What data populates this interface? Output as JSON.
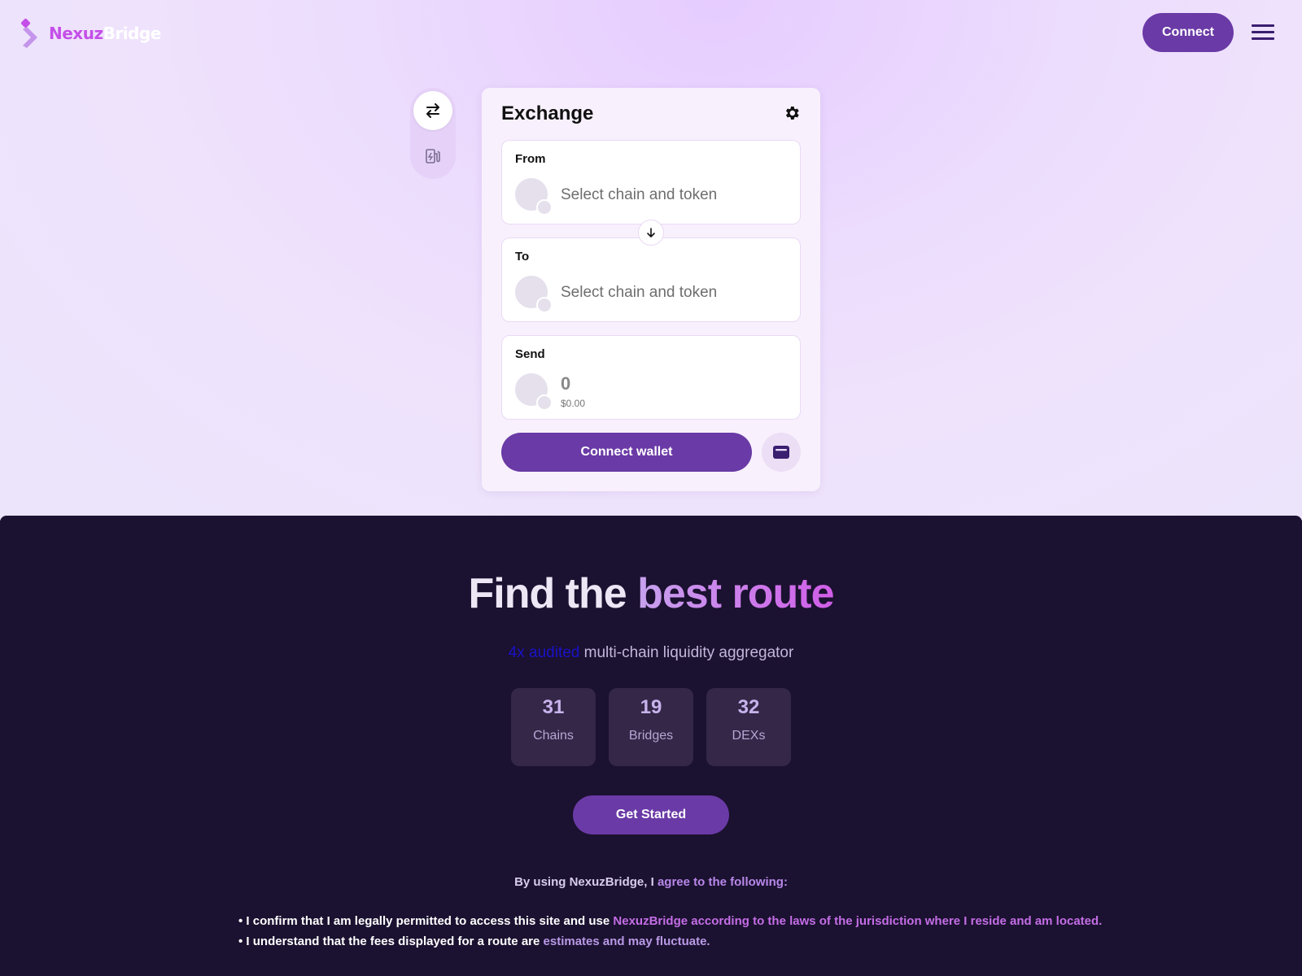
{
  "brand": {
    "name_part1": "Nexuz",
    "name_part2": "Bridge"
  },
  "header": {
    "connect_label": "Connect"
  },
  "widget": {
    "title": "Exchange",
    "from": {
      "label": "From",
      "placeholder": "Select chain and token"
    },
    "to": {
      "label": "To",
      "placeholder": "Select chain and token"
    },
    "send": {
      "label": "Send",
      "amount": "0",
      "usd_value": "$0.00"
    },
    "connect_wallet_label": "Connect wallet"
  },
  "hero": {
    "headline_plain": "Find the",
    "headline_gradient": "best route",
    "sub_link": "4x audited",
    "sub_rest": "multi-chain liquidity aggregator",
    "stats": [
      {
        "value": "31",
        "label": "Chains"
      },
      {
        "value": "19",
        "label": "Bridges"
      },
      {
        "value": "32",
        "label": "DEXs"
      }
    ],
    "cta_label": "Get Started"
  },
  "agreement": {
    "intro_a": "By using NexuzBridge, I ",
    "intro_b": "agree to the following:",
    "term1_a": "• I confirm that I am legally permitted to access this site and use ",
    "term1_b": "NexuzBridge according to the laws of the jurisdiction where I reside and am located.",
    "term2_a": "• I understand that the fees displayed for a route are ",
    "term2_b": "estimates and may fluctuate."
  },
  "colors": {
    "accent": "#6a3aa6",
    "brand_pink": "#c44fe8",
    "dark_bg": "#1b1130"
  },
  "icons": [
    "logo-icon",
    "swap-icon",
    "gas-station-icon",
    "gear-icon",
    "arrow-down-icon",
    "wallet-icon",
    "menu-icon"
  ]
}
